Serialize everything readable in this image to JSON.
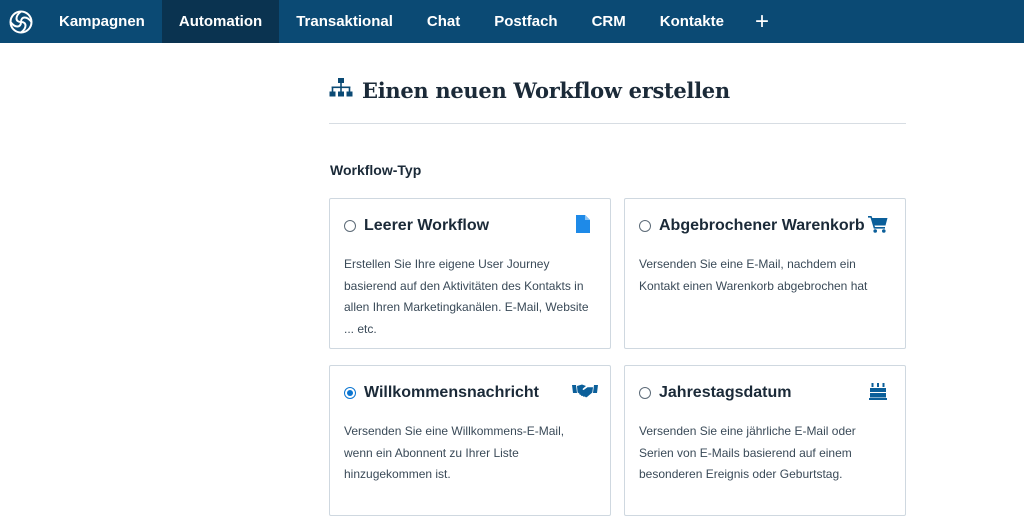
{
  "nav": {
    "items": [
      {
        "label": "Kampagnen",
        "active": false
      },
      {
        "label": "Automation",
        "active": true
      },
      {
        "label": "Transaktional",
        "active": false
      },
      {
        "label": "Chat",
        "active": false
      },
      {
        "label": "Postfach",
        "active": false
      },
      {
        "label": "CRM",
        "active": false
      },
      {
        "label": "Kontakte",
        "active": false
      }
    ],
    "plus_label": "+",
    "logo_icon": "spiral-logo-icon"
  },
  "header": {
    "title": "Einen neuen Workflow erstellen",
    "icon": "sitemap-icon"
  },
  "workflow_type": {
    "label": "Workflow-Typ",
    "options": [
      {
        "title": "Leerer Workflow",
        "description": "Erstellen Sie Ihre eigene User Journey basierend auf den Aktivitäten des Kontakts in allen Ihren Marketingkanälen. E-Mail, Website ... etc.",
        "icon": "document-icon",
        "selected": false
      },
      {
        "title": "Abgebrochener Warenkorb",
        "description": "Versenden Sie eine E-Mail, nachdem ein Kontakt einen Warenkorb abgebrochen hat",
        "icon": "cart-icon",
        "selected": false
      },
      {
        "title": "Willkommensnachricht",
        "description": "Versenden Sie eine Willkommens-E-Mail, wenn ein Abonnent zu Ihrer Liste hinzugekommen ist.",
        "icon": "handshake-icon",
        "selected": true
      },
      {
        "title": "Jahrestagsdatum",
        "description": "Versenden Sie eine jährliche E-Mail oder Serien von E-Mails basierend auf einem besonderen Ereignis oder Geburtstag.",
        "icon": "birthday-cake-icon",
        "selected": false
      }
    ]
  },
  "colors": {
    "nav_bg": "#0b4a74",
    "nav_active_bg": "#0a3350",
    "accent": "#0b75d1"
  }
}
